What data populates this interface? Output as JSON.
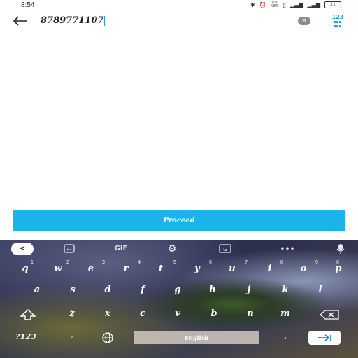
{
  "status_bar": {
    "time": "8:54",
    "icons": [
      "bluetooth-icon",
      "alarm-icon",
      "data-speed-icon",
      "vibrate-icon",
      "signal-icon",
      "volte-icon",
      "battery-icon"
    ],
    "data_speed": "0.00 KB/S",
    "battery": "21"
  },
  "search": {
    "value": "8789771107"
  },
  "numpad_toggle": {
    "label": "123"
  },
  "proceed": {
    "label": "Proceed"
  },
  "keyboard": {
    "toolbar": {
      "back": "<",
      "gif": "GIF"
    },
    "row1": [
      {
        "key": "q",
        "hint": "1"
      },
      {
        "key": "w",
        "hint": "2"
      },
      {
        "key": "e",
        "hint": "3"
      },
      {
        "key": "r",
        "hint": "4"
      },
      {
        "key": "t",
        "hint": "5"
      },
      {
        "key": "y",
        "hint": "6"
      },
      {
        "key": "u",
        "hint": "7"
      },
      {
        "key": "i",
        "hint": "8"
      },
      {
        "key": "o",
        "hint": "9"
      },
      {
        "key": "p",
        "hint": "0"
      }
    ],
    "row2": [
      "a",
      "s",
      "d",
      "f",
      "g",
      "h",
      "j",
      "k",
      "l"
    ],
    "row3": [
      "z",
      "x",
      "c",
      "v",
      "b",
      "n",
      "m"
    ],
    "bottom": {
      "symbols": "?123",
      "space_label": "English"
    }
  },
  "colors": {
    "accent": "#1bb3ec",
    "search_underline": "#4fb6e6"
  }
}
